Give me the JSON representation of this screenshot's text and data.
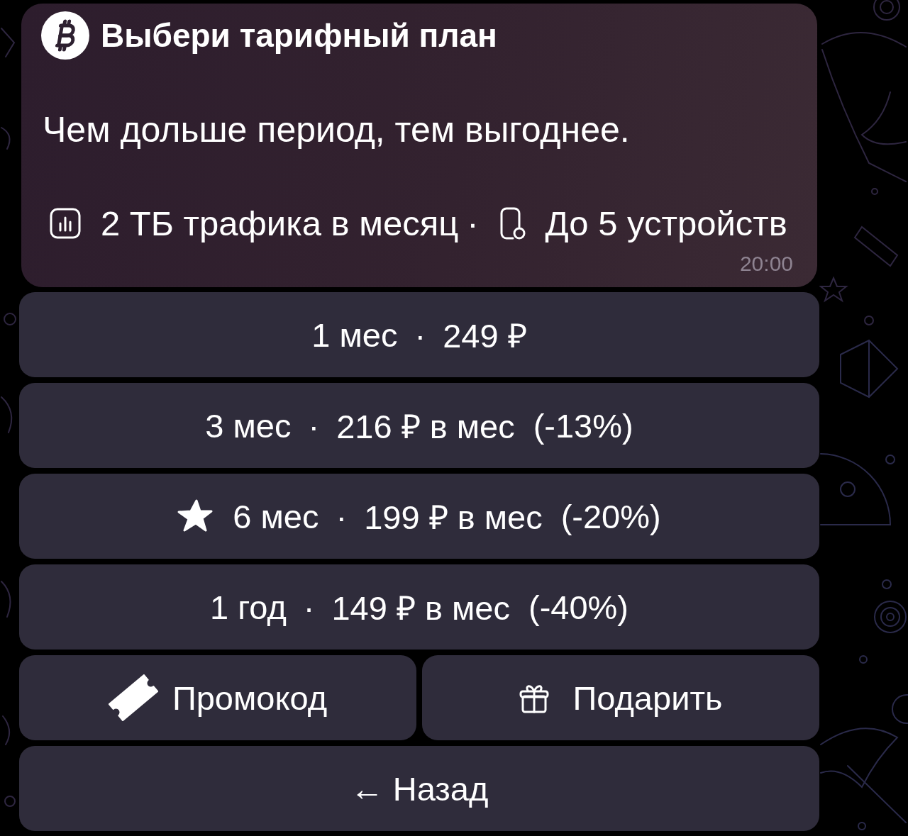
{
  "message": {
    "title": "Выбери тарифный план",
    "body": "Чем дольше период, тем выгоднее.",
    "features": {
      "items": [
        {
          "kind": "traffic",
          "text": "2 ТБ трафика в месяц"
        },
        {
          "kind": "devices",
          "text": "До 5 устройств"
        }
      ],
      "separator": "·"
    },
    "time": "20:00"
  },
  "plans": [
    {
      "period": "1 мес",
      "separator": "·",
      "price": "249 ₽",
      "starred": false
    },
    {
      "period": "3 мес",
      "separator": "·",
      "price": "216 ₽ в мес",
      "discount": "(-13%)",
      "starred": false
    },
    {
      "period": "6 мес",
      "separator": "·",
      "price": "199 ₽ в мес",
      "discount": "(-20%)",
      "starred": true
    },
    {
      "period": "1 год",
      "separator": "·",
      "price": "149 ₽ в мес",
      "discount": "(-40%)",
      "starred": false
    }
  ],
  "actions": [
    {
      "kind": "promo",
      "label": "Промокод"
    },
    {
      "kind": "gift",
      "label": "Подарить"
    }
  ],
  "back": {
    "label": "← Назад"
  }
}
